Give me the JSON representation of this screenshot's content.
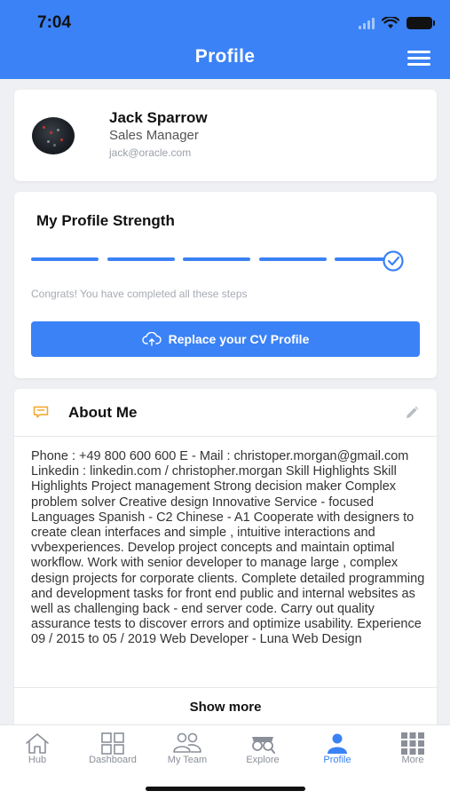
{
  "status_bar": {
    "time": "7:04"
  },
  "header": {
    "title": "Profile",
    "menu_icon": "hamburger-menu-icon"
  },
  "user": {
    "name": "Jack Sparrow",
    "role": "Sales Manager",
    "email": "jack@oracle.com",
    "avatar_icon": "avatar-image"
  },
  "strength": {
    "title": "My Profile Strength",
    "steps_completed": 5,
    "steps_total": 5,
    "message": "Congrats! You have completed all these steps",
    "button_label": "Replace your CV Profile",
    "button_icon": "cloud-upload-icon"
  },
  "about": {
    "title": "About Me",
    "header_icon": "speech-bubble-icon",
    "edit_icon": "pencil-icon",
    "body": "Phone : +49 800 600 600 E - Mail : christoper.morgan@gmail.com Linkedin : linkedin.com / christopher.morgan Skill Highlights Skill Highlights Project management Strong decision maker Complex problem solver Creative design Innovative Service - focused Languages Spanish - C2 Chinese - A1 Cooperate with designers to create clean interfaces and simple , intuitive interactions and vvbexperiences. Develop project concepts and maintain optimal workflow. Work with senior developer to manage large , complex design projects for corporate clients. Complete detailed programming and development tasks for front end public and internal websites as well as challenging back - end server code. Carry out quality assurance tests to discover errors and optimize usability. Experience 09 / 2015 to 05 / 2019 Web Developer - Luna Web Design",
    "show_more": "Show more"
  },
  "tabs": [
    {
      "label": "Hub",
      "icon": "home-icon",
      "active": false
    },
    {
      "label": "Dashboard",
      "icon": "dashboard-grid-icon",
      "active": false
    },
    {
      "label": "My Team",
      "icon": "team-icon",
      "active": false
    },
    {
      "label": "Explore",
      "icon": "explore-binoculars-icon",
      "active": false
    },
    {
      "label": "Profile",
      "icon": "profile-icon",
      "active": true
    },
    {
      "label": "More",
      "icon": "more-grid-icon",
      "active": false
    }
  ],
  "colors": {
    "primary": "#3b82f6",
    "accent_icon": "#f5a623",
    "inactive": "#8a8f99"
  }
}
